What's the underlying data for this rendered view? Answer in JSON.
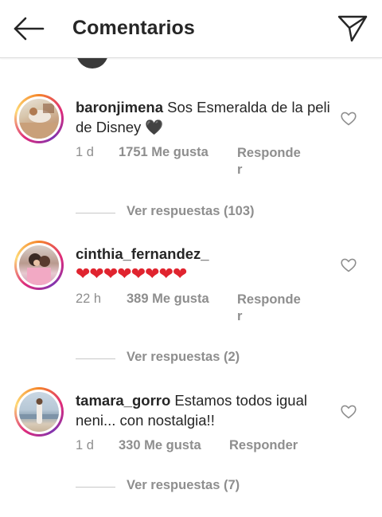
{
  "header": {
    "title": "Comentarios",
    "back_icon": "arrow-left-icon",
    "send_icon": "paper-plane-icon"
  },
  "comments": [
    {
      "username": "baronjimena",
      "text": "Sos Esmeralda de la peli de Disney 🖤",
      "time": "1 d",
      "likes": "1751 Me gusta",
      "reply": "Responder",
      "view_replies": "Ver respuestas (103)"
    },
    {
      "username": "cinthia_fernandez_",
      "text": "❤❤❤❤❤❤❤❤",
      "time": "22 h",
      "likes": "389 Me gusta",
      "reply": "Responder",
      "view_replies": "Ver respuestas (2)"
    },
    {
      "username": "tamara_gorro",
      "text": "Estamos todos igual neni... con nostalgia!!",
      "time": "1 d",
      "likes": "330 Me gusta",
      "reply": "Responder",
      "view_replies": "Ver respuestas (7)"
    }
  ],
  "colors": {
    "text": "#262626",
    "muted": "#8e8e8e",
    "heart_red": "#e0242f",
    "divider": "#dbdbdb"
  }
}
